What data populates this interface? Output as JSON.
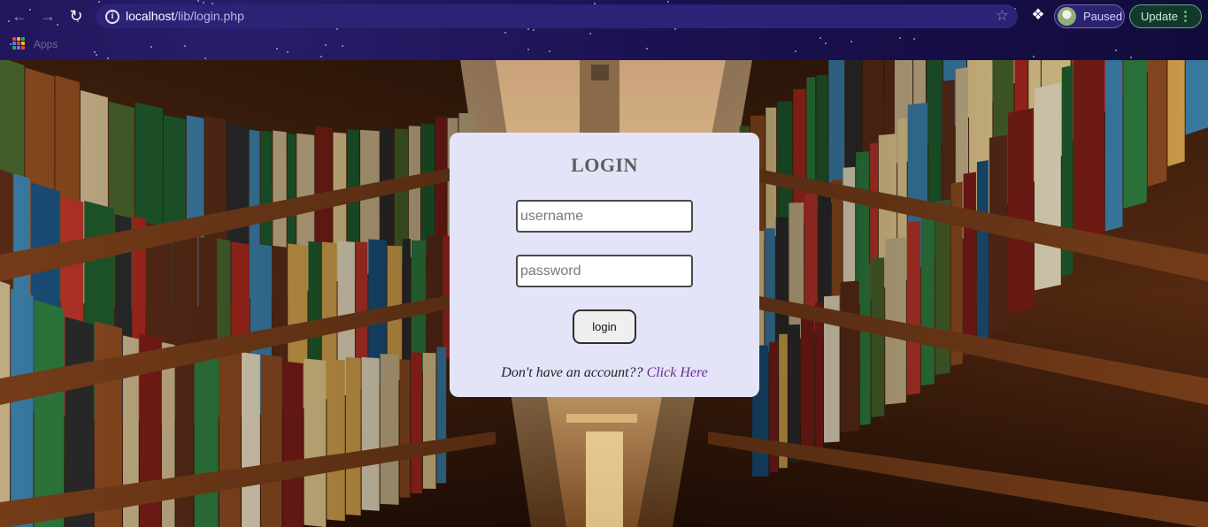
{
  "browser": {
    "url_host": "localhost",
    "url_path": "/lib/login.php",
    "profile_status": "Paused",
    "update_label": "Update",
    "bookmarks_apps_label": "Apps",
    "icons": [
      "back-arrow-icon",
      "forward-arrow-icon",
      "reload-icon",
      "info-icon",
      "bookmark-star-icon",
      "extensions-puzzle-icon",
      "menu-dots-icon",
      "apps-grid-icon"
    ]
  },
  "login": {
    "title": "LOGIN",
    "username_placeholder": "username",
    "password_placeholder": "password",
    "submit_label": "login",
    "signup_prompt": "Don't have an account??",
    "signup_link": "Click Here"
  },
  "colors": {
    "card_background": "#e4e4f8",
    "link": "#6a2a93",
    "chrome_background": "#1a1150"
  }
}
